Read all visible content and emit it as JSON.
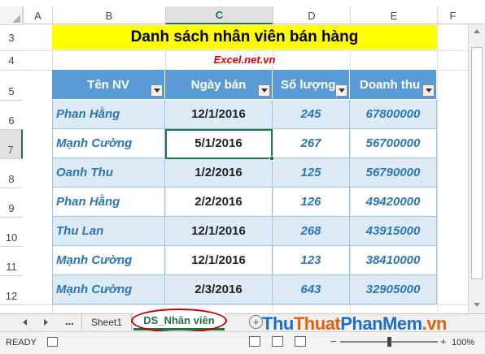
{
  "columns": [
    "A",
    "B",
    "C",
    "D",
    "E",
    "F"
  ],
  "selected_column": "C",
  "rows": [
    "3",
    "4",
    "5",
    "6",
    "7",
    "8",
    "9",
    "10",
    "11",
    "12"
  ],
  "selected_row": "7",
  "title": "Danh sách nhân viên bán hàng",
  "subtitle": "Excel.net.vn",
  "table": {
    "headers": [
      "Tên NV",
      "Ngày bán",
      "Số lượng",
      "Doanh thu"
    ],
    "rows": [
      [
        "Phan Hằng",
        "12/1/2016",
        "245",
        "67800000"
      ],
      [
        "Mạnh Cường",
        "5/1/2016",
        "267",
        "56700000"
      ],
      [
        "Oanh Thu",
        "1/2/2016",
        "125",
        "56790000"
      ],
      [
        "Phan Hằng",
        "2/2/2016",
        "126",
        "49420000"
      ],
      [
        "Thu Lan",
        "12/1/2016",
        "268",
        "43915000"
      ],
      [
        "Mạnh Cường",
        "12/1/2016",
        "123",
        "38410000"
      ],
      [
        "Mạnh Cường",
        "2/3/2016",
        "643",
        "32905000"
      ]
    ]
  },
  "sheet_tabs": {
    "overflow": "...",
    "tabs": [
      "Sheet1",
      "DS_Nhân viên"
    ],
    "active": "DS_Nhân viên",
    "add": "+"
  },
  "watermark": {
    "part1": "Thu",
    "part2": "Thuat",
    "part3": "PhanMem",
    "part4": ".vn"
  },
  "status": {
    "ready": "READY",
    "zoom": "100%",
    "minus": "−",
    "plus": "+"
  },
  "colors": {
    "header_fill": "#5b9bd5",
    "band_fill": "#ddebf7",
    "title_fill": "#ffff00",
    "accent": "#217346"
  }
}
